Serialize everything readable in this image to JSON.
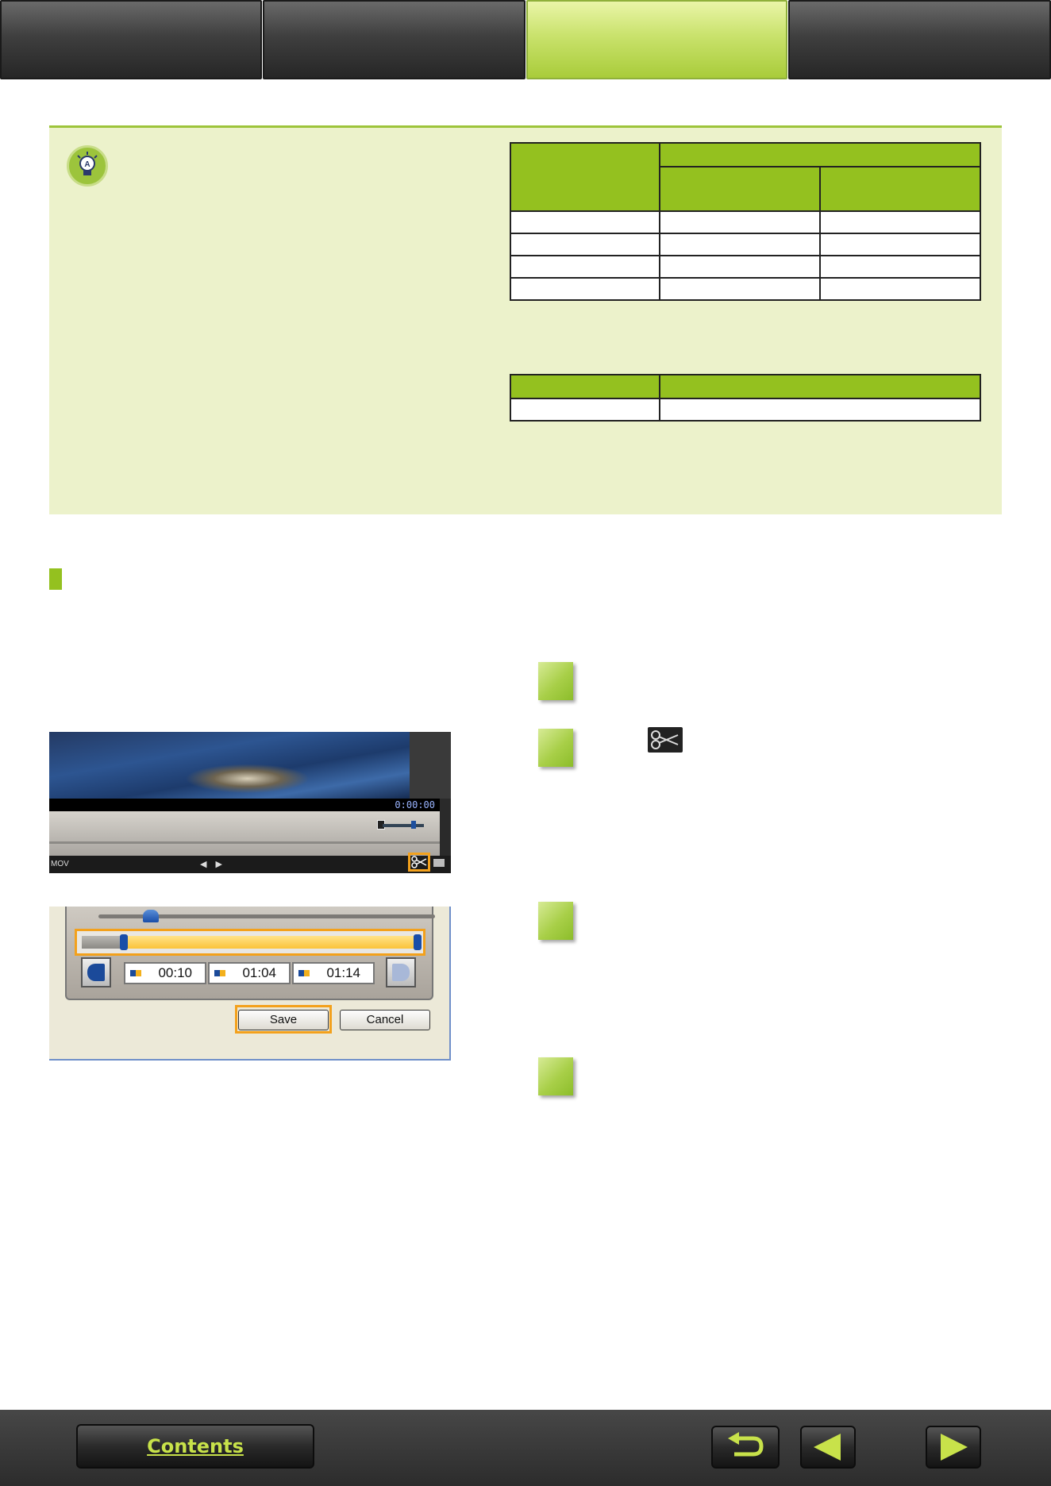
{
  "screenshot_player": {
    "timecode": "0:00:00",
    "file_type": "MOV",
    "nav_arrows": "◀ ▶",
    "cut_icon": "scissors-icon"
  },
  "screenshot_trim": {
    "start_time": "00:10",
    "duration": "01:04",
    "end_time": "01:14",
    "save_label": "Save",
    "cancel_label": "Cancel"
  },
  "footer": {
    "contents_label": "Contents",
    "icons": [
      "back-arrow-icon",
      "previous-page-icon",
      "next-page-icon"
    ]
  },
  "colors": {
    "accent_green": "#94c11f",
    "hint_background": "#ecf2cb",
    "highlight_orange": "#f3a11c"
  }
}
